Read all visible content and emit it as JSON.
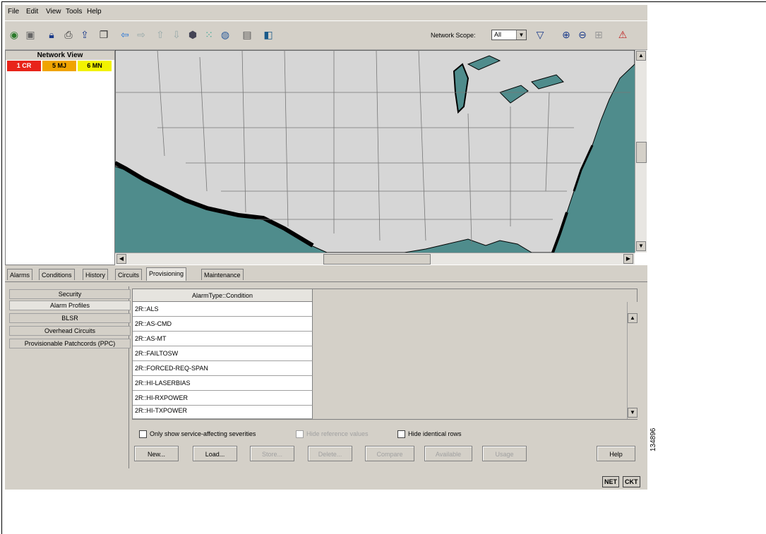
{
  "menu": [
    "File",
    "Edit",
    "View",
    "Tools",
    "Help"
  ],
  "toolbar": {
    "icons": [
      "globe-icon",
      "home-icon",
      "lock-icon",
      "print-icon",
      "export-icon",
      "window-icon",
      "back-icon",
      "forward-icon",
      "up-icon",
      "down-icon",
      "network-icon",
      "grid-icon",
      "globe-icon",
      "tile-icon",
      "chart-icon"
    ],
    "scope_label": "Network Scope:",
    "scope_value": "All",
    "right_icons": [
      "filter-icon",
      "zoom-in-icon",
      "zoom-out-icon",
      "fit-icon",
      "pdf-icon"
    ]
  },
  "network_view": {
    "title": "Network View",
    "alarms": [
      {
        "label": "1 CR",
        "color": "#e8241a"
      },
      {
        "label": "5 MJ",
        "color": "#f0a400"
      },
      {
        "label": "6 MN",
        "color": "#f2f200"
      }
    ]
  },
  "tabs": [
    "Alarms",
    "Conditions",
    "History",
    "Circuits",
    "Provisioning",
    "Maintenance"
  ],
  "active_tab": "Provisioning",
  "side_menu": [
    "Security",
    "Alarm Profiles",
    "BLSR",
    "Overhead Circuits",
    "Provisionable Patchcords (PPC)"
  ],
  "table": {
    "header": "AlarmType::Condition",
    "rows": [
      "2R::ALS",
      "2R::AS-CMD",
      "2R::AS-MT",
      "2R::FAILTOSW",
      "2R::FORCED-REQ-SPAN",
      "2R::HI-LASERBIAS",
      "2R::HI-RXPOWER",
      "2R::HI-TXPOWER"
    ]
  },
  "checkboxes": [
    {
      "label": "Only show service-affecting severities",
      "enabled": true
    },
    {
      "label": "Hide reference values",
      "enabled": false
    },
    {
      "label": "Hide identical rows",
      "enabled": true
    }
  ],
  "buttons": [
    {
      "label": "New...",
      "enabled": true
    },
    {
      "label": "Load...",
      "enabled": true
    },
    {
      "label": "Store...",
      "enabled": false
    },
    {
      "label": "Delete...",
      "enabled": false
    },
    {
      "label": "Compare",
      "enabled": false
    },
    {
      "label": "Available",
      "enabled": false
    },
    {
      "label": "Usage",
      "enabled": false
    },
    {
      "label": "Help",
      "enabled": true
    }
  ],
  "status": [
    "NET",
    "CKT"
  ],
  "figure_id": "134896"
}
